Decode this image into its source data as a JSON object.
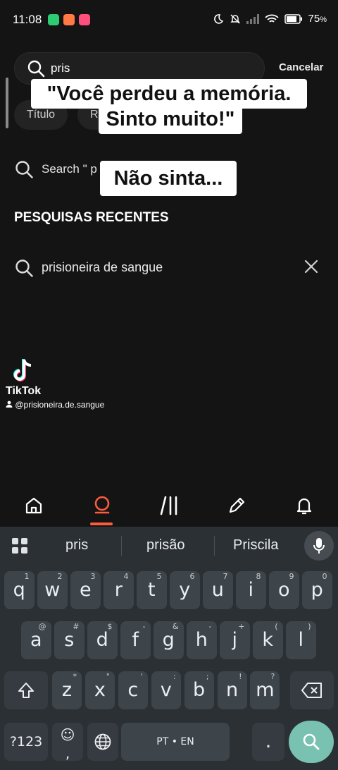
{
  "status_bar": {
    "time": "11:08",
    "battery": "75",
    "battery_unit": "%",
    "notification_colors": [
      "#2ecc71",
      "#ff7a45",
      "#ff4f7d"
    ]
  },
  "search": {
    "query": "pris",
    "cancel_label": "Cancelar",
    "filter_chips": [
      "Título",
      "R"
    ],
    "suggestion_text": "Search \" p"
  },
  "captions": {
    "line1": "\"Você perdeu a memória.",
    "line2": "Sinto muito!\"",
    "line3": "Não sinta..."
  },
  "recent": {
    "title": "PESQUISAS RECENTES",
    "items": [
      {
        "text": "prisioneira de sangue"
      }
    ]
  },
  "watermark": {
    "brand": "TikTok",
    "username": "@prisioneira.de.sangue"
  },
  "bottom_nav": {
    "items": [
      "home-icon",
      "search-icon",
      "library-icon",
      "pencil-icon",
      "bell-icon"
    ],
    "active": "search-icon",
    "accent_color": "#ff5a3c"
  },
  "keyboard": {
    "suggestions": [
      "pris",
      "prisão",
      "Priscila"
    ],
    "row1": [
      {
        "k": "q",
        "s": "1"
      },
      {
        "k": "w",
        "s": "2"
      },
      {
        "k": "e",
        "s": "3"
      },
      {
        "k": "r",
        "s": "4"
      },
      {
        "k": "t",
        "s": "5"
      },
      {
        "k": "y",
        "s": "6"
      },
      {
        "k": "u",
        "s": "7"
      },
      {
        "k": "i",
        "s": "8"
      },
      {
        "k": "o",
        "s": "9"
      },
      {
        "k": "p",
        "s": "0"
      }
    ],
    "row2": [
      {
        "k": "a",
        "s": "@"
      },
      {
        "k": "s",
        "s": "#"
      },
      {
        "k": "d",
        "s": "$"
      },
      {
        "k": "f",
        "s": "-"
      },
      {
        "k": "g",
        "s": "&"
      },
      {
        "k": "h",
        "s": "-"
      },
      {
        "k": "j",
        "s": "+"
      },
      {
        "k": "k",
        "s": "("
      },
      {
        "k": "l",
        "s": ")"
      }
    ],
    "row3": [
      {
        "k": "z",
        "s": "*"
      },
      {
        "k": "x",
        "s": "\""
      },
      {
        "k": "c",
        "s": "'"
      },
      {
        "k": "v",
        "s": ":"
      },
      {
        "k": "b",
        "s": ";"
      },
      {
        "k": "n",
        "s": "!"
      },
      {
        "k": "m",
        "s": "?"
      }
    ],
    "symbols_label": "?123",
    "emoji_label": "☺",
    "comma_label": ",",
    "period_label": ".",
    "space_label": "PT • EN",
    "search_key_color": "#79c1b0"
  }
}
